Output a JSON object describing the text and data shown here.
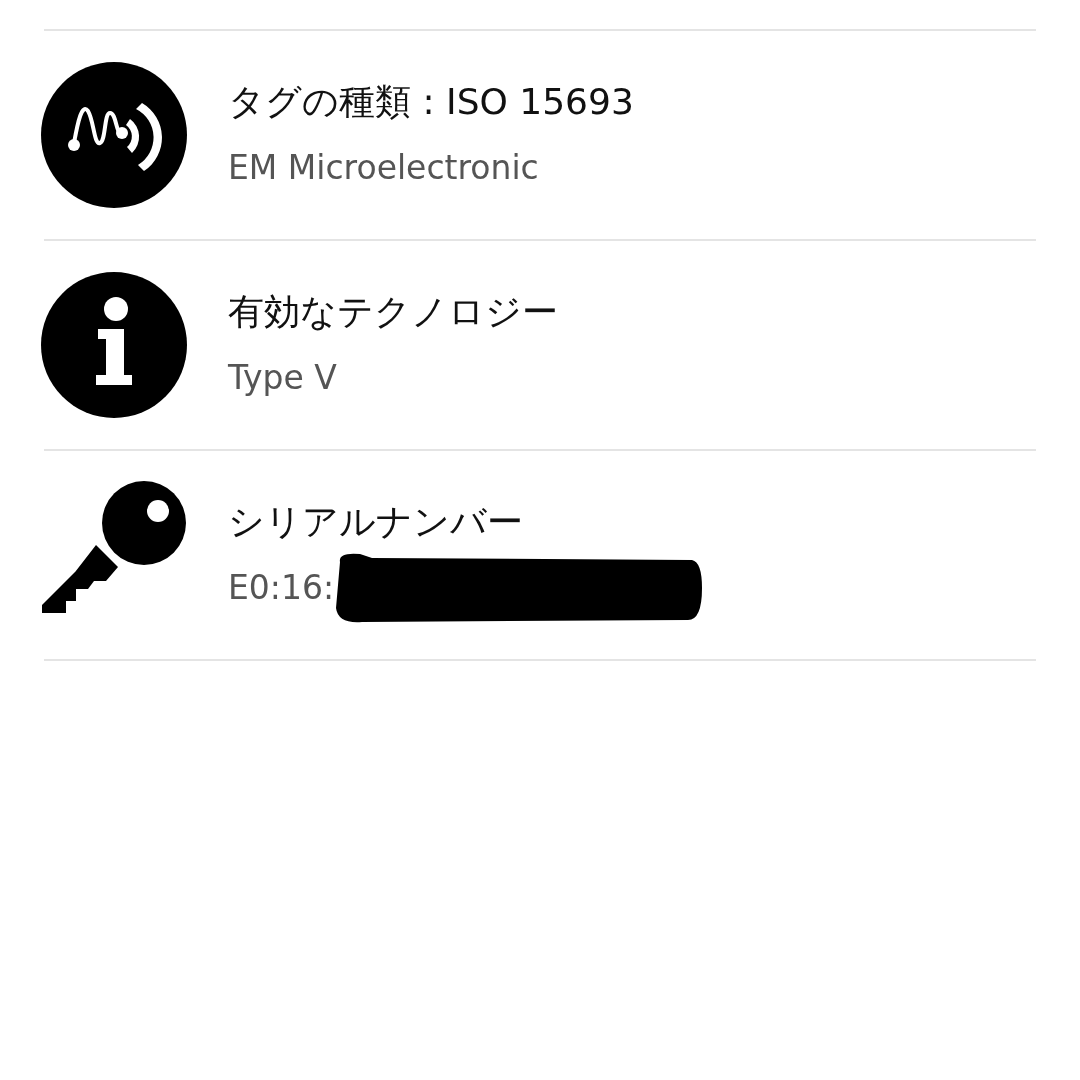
{
  "rows": [
    {
      "kind": "tag",
      "title": "タグの種類 : ISO 15693",
      "detail": "EM Microelectronic",
      "redacted": false
    },
    {
      "kind": "info",
      "title": "有効なテクノロジー",
      "detail": "Type V",
      "redacted": false
    },
    {
      "kind": "key",
      "title": "シリアルナンバー",
      "detail": "E0:16:",
      "redacted": true
    }
  ]
}
